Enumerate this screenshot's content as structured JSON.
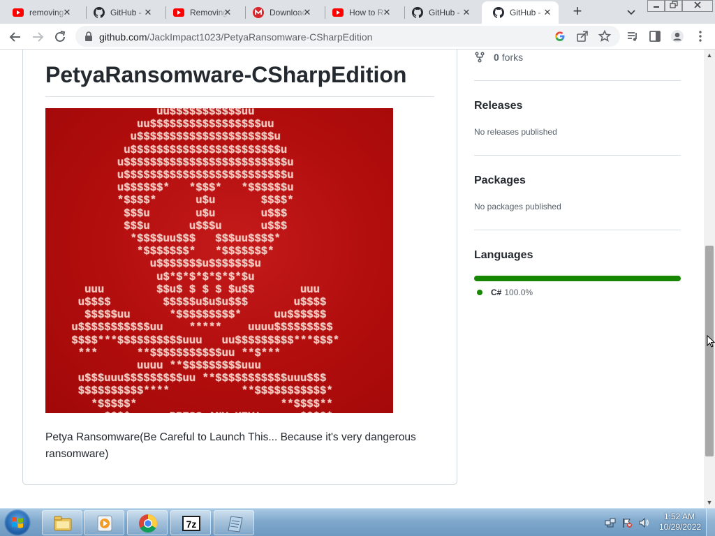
{
  "browser": {
    "tabs": [
      {
        "title": "removing",
        "icon": "youtube-icon",
        "active": false
      },
      {
        "title": "GitHub -",
        "icon": "github-icon",
        "active": false
      },
      {
        "title": "Removing",
        "icon": "youtube-icon",
        "active": false
      },
      {
        "title": "Download",
        "icon": "mega-icon",
        "active": false
      },
      {
        "title": "How to R",
        "icon": "youtube-icon",
        "active": false
      },
      {
        "title": "GitHub -",
        "icon": "github-icon",
        "active": false
      },
      {
        "title": "GitHub -",
        "icon": "github-icon",
        "active": true
      }
    ],
    "close_glyph": "✕",
    "new_tab_glyph": "+",
    "url_host": "github.com",
    "url_path": "/JackImpact1023/PetyaRansomware-CSharpEdition",
    "colors": {
      "tab_strip": "#dee1e6",
      "youtube_red": "#ff0000",
      "mega_red": "#d9272e"
    }
  },
  "repo": {
    "title": "PetyaRansomware-CSharpEdition",
    "image_art": [
      "                 uu$$$$$$$$$$$uu",
      "              uu$$$$$$$$$$$$$$$$$uu",
      "             u$$$$$$$$$$$$$$$$$$$$$u",
      "            u$$$$$$$$$$$$$$$$$$$$$$$u",
      "           u$$$$$$$$$$$$$$$$$$$$$$$$$u",
      "           u$$$$$$$$$$$$$$$$$$$$$$$$$u",
      "           u$$$$$$*   *$$$*   *$$$$$$u",
      "           *$$$$*      u$u       $$$$*",
      "            $$$u       u$u       u$$$",
      "            $$$u      u$$$u      u$$$",
      "             *$$$$uu$$$   $$$uu$$$$*",
      "              *$$$$$$$*   *$$$$$$$*",
      "                u$$$$$$$u$$$$$$$u",
      "                 u$*$*$*$*$*$*$u",
      "      uuu        $$u$ $ $ $ $u$$       uuu",
      "     u$$$$        $$$$$u$u$u$$$       u$$$$",
      "      $$$$$uu      *$$$$$$$$$*     uu$$$$$$",
      "    u$$$$$$$$$$$uu    *****    uuuu$$$$$$$$$",
      "    $$$$***$$$$$$$$$$uuu   uu$$$$$$$$$***$$$*",
      "     ***      **$$$$$$$$$$$uu **$***",
      "              uuuu **$$$$$$$$$uuu",
      "     u$$$uuu$$$$$$$$$uu **$$$$$$$$$$$uuu$$$",
      "     $$$$$$$$$$****           **$$$$$$$$$$$*",
      "       *$$$$$*                      **$$$$**",
      "         $$$*      PRESS ANY KEY!      $$$$*"
    ],
    "description": "Petya Ransomware(Be Careful to Launch This... Because it's very dangerous ransomware)"
  },
  "sidebar": {
    "fork_count": "0",
    "fork_label": "forks",
    "releases_heading": "Releases",
    "releases_note": "No releases published",
    "packages_heading": "Packages",
    "packages_note": "No packages published",
    "languages_heading": "Languages",
    "language": {
      "name": "C#",
      "percent": "100.0%",
      "percent_value": 100,
      "color": "#178600"
    }
  },
  "taskbar": {
    "time": "1:52 AM",
    "date": "10/29/2022",
    "apps": [
      "explorer-icon",
      "media-player-icon",
      "chrome-icon",
      "7zip-icon",
      "notepad-icon"
    ],
    "seven_zip_label": "7z"
  }
}
